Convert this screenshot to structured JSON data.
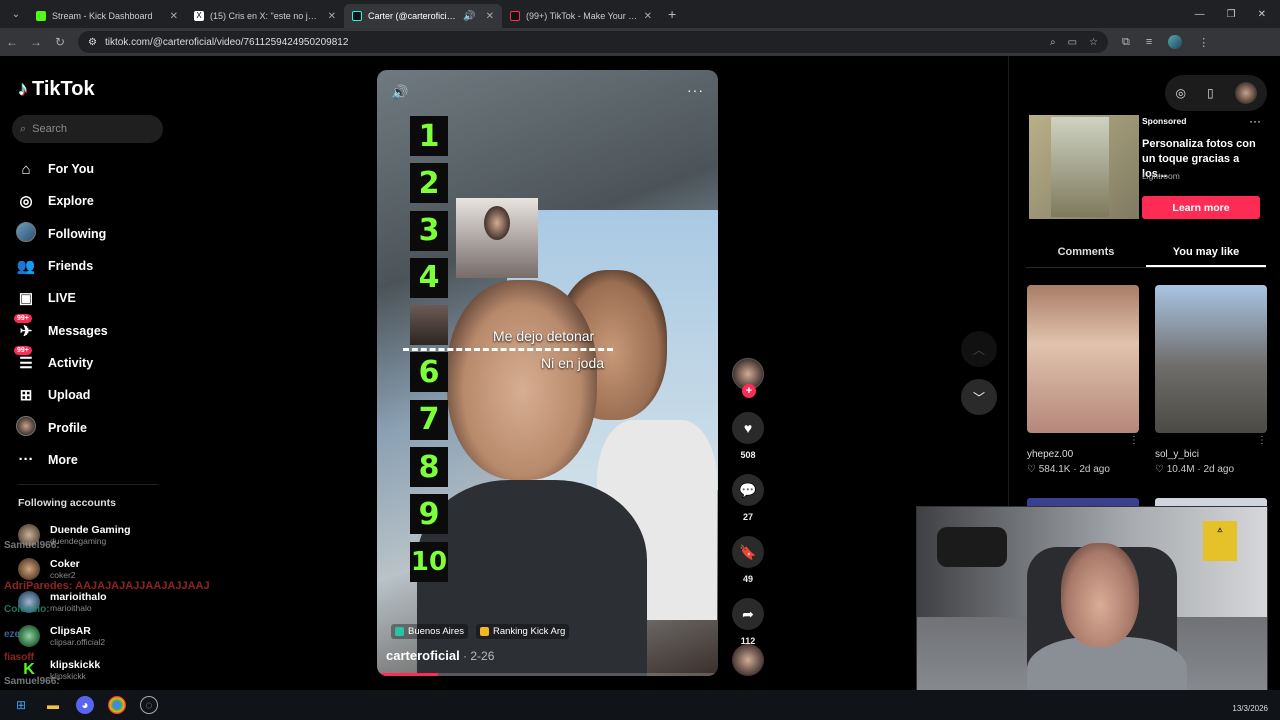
{
  "browser": {
    "tabs": [
      {
        "title": "Stream - Kick Dashboard",
        "favicon_color": "#53fc18",
        "active": false
      },
      {
        "title": "(15) Cris en X: \"este no jode ma",
        "favicon_color": "#000000",
        "active": false
      },
      {
        "title": "Carter (@carteroficial)'s vid",
        "favicon_color": "#000000",
        "active": true
      },
      {
        "title": "(99+) TikTok - Make Your Day",
        "favicon_color": "#000000",
        "active": false
      }
    ],
    "new_tab": "+",
    "url": "tiktok.com/@carteroficial/video/7611259424950209812"
  },
  "tiktok": {
    "logo": "TikTok",
    "search_placeholder": "Search",
    "nav": [
      {
        "label": "For You",
        "icon": "home-icon"
      },
      {
        "label": "Explore",
        "icon": "compass-icon"
      },
      {
        "label": "Following",
        "icon": "avatar-icon"
      },
      {
        "label": "Friends",
        "icon": "friends-icon"
      },
      {
        "label": "LIVE",
        "icon": "live-icon"
      },
      {
        "label": "Messages",
        "icon": "messages-icon",
        "badge": "99+"
      },
      {
        "label": "Activity",
        "icon": "activity-icon",
        "badge": "99+"
      },
      {
        "label": "Upload",
        "icon": "upload-icon"
      },
      {
        "label": "Profile",
        "icon": "profile-icon"
      },
      {
        "label": "More",
        "icon": "more-icon"
      }
    ],
    "following_title": "Following accounts",
    "accounts": [
      {
        "name": "Duende Gaming",
        "handle": "duendegaming",
        "color": "#7a6a5a"
      },
      {
        "name": "Coker",
        "handle": "coker2",
        "color": "#8a6b4f"
      },
      {
        "name": "marioithalo",
        "handle": "marioithalo",
        "color": "#4f6f8a"
      },
      {
        "name": "ClipsAR",
        "handle": "clipsar.official2",
        "color": "#2e8b57"
      },
      {
        "name": "klipskickk",
        "handle": "klipskickk",
        "color": "#53fc18"
      }
    ]
  },
  "chat_overlay": [
    {
      "text": "Samuel966:",
      "color": "#9aa0a6"
    },
    {
      "text": "AdriParedes: AAJAJAJAJJAAJAJJAAJ",
      "color": "#c03030"
    },
    {
      "text": "Colencio:",
      "color": "#20a070"
    },
    {
      "text": "eze",
      "color": "#5080c0"
    },
    {
      "text": "fiasoff",
      "color": "#c03030"
    },
    {
      "text": "Samuel966:",
      "color": "#9aa0a6"
    }
  ],
  "video": {
    "ranks": [
      "1",
      "2",
      "3",
      "4",
      "",
      "6",
      "7",
      "8",
      "9",
      "10"
    ],
    "caption_top": "Me dejo detonar",
    "caption_bottom": "Ni en joda",
    "tags": [
      "Buenos Aires",
      "Ranking Kick Arg"
    ],
    "author": "carteroficial",
    "date": " · 2-26",
    "progress_percent": 18
  },
  "actions": {
    "likes": "508",
    "comments": "27",
    "saves": "49",
    "shares": "112"
  },
  "ad": {
    "sponsored": "Sponsored",
    "title": "Personaliza fotos con un toque gracias a los...",
    "brand": "Lightroom",
    "cta": "Learn more"
  },
  "panel_tabs": [
    "Comments",
    "You may like"
  ],
  "suggestions": [
    {
      "user": "yhepez.00",
      "views": "584.1K",
      "age": "2d ago"
    },
    {
      "user": "sol_y_bici",
      "views": "10.4M",
      "age": "2d ago"
    }
  ],
  "taskbar": {
    "date": "13/3/2026"
  },
  "colors": {
    "accent": "#fe2c55",
    "rank_green": "#7dff3a"
  }
}
